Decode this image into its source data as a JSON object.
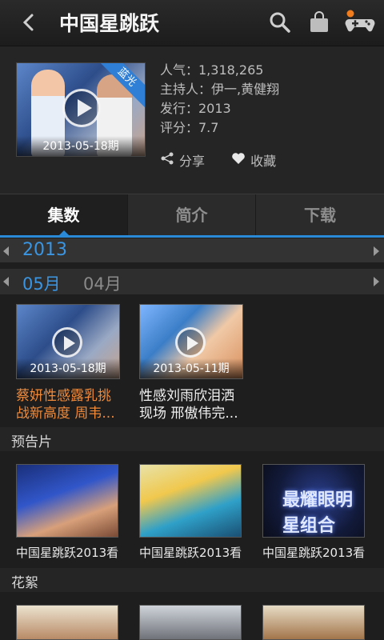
{
  "header": {
    "title": "中国星跳跃",
    "back_icon": "chevron-left-icon",
    "search_icon": "search-icon",
    "bag_icon": "shopping-bag-icon",
    "game_icon": "gamepad-icon"
  },
  "info": {
    "poster_badge": "蓝光",
    "poster_date": "2013-05-18期",
    "popularity": "人气：1,318,265",
    "hosts": "主持人：伊一,黄健翔",
    "release": "发行：2013",
    "rating": "评分：7.7",
    "share_label": "分享",
    "favorite_label": "收藏"
  },
  "tabs": [
    "集数",
    "简介",
    "下载"
  ],
  "episodes": {
    "year": "2013",
    "month_active": "05月",
    "month_other": "04月",
    "items": [
      {
        "date": "2013-05-18期",
        "title": "蔡妍性感露乳挑战新高度 周韦..."
      },
      {
        "date": "2013-05-11期",
        "title": "性感刘雨欣泪洒现场 邢傲伟完..."
      }
    ]
  },
  "trailers": {
    "label": "预告片",
    "items": [
      {
        "title": "中国星跳跃2013看"
      },
      {
        "title": "中国星跳跃2013看"
      },
      {
        "title": "中国星跳跃2013看",
        "overlay": "最耀眼明星组合"
      }
    ]
  },
  "highlights": {
    "label": "花絮"
  },
  "colors": {
    "accent": "#3a95e2",
    "highlight_title": "#ef8a3a"
  }
}
